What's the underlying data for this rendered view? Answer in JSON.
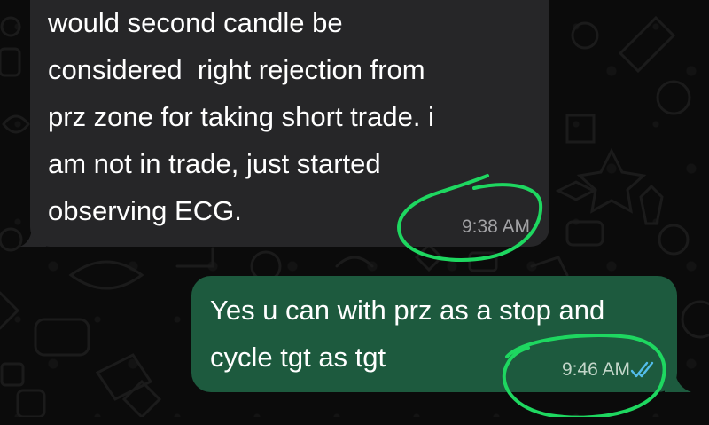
{
  "messages": [
    {
      "direction": "incoming",
      "text": "would second candle be\nconsidered  right rejection from\nprz zone for taking short trade. i\nam not in trade, just started\nobserving ECG.",
      "time": "9:38 AM"
    },
    {
      "direction": "outgoing",
      "text": "Yes u can with prz as a stop and\ncycle tgt as tgt",
      "time": "9:46 AM",
      "status": "read",
      "status_icon": "double-check-icon"
    }
  ],
  "colors": {
    "background": "#0b0b0b",
    "incoming_bubble": "#262628",
    "outgoing_bubble": "#1d5a3e",
    "read_ticks": "#53bdeb",
    "annotation": "#1ed760"
  },
  "annotations": [
    {
      "type": "hand-drawn-circle",
      "around": "messages.0.time"
    },
    {
      "type": "hand-drawn-circle",
      "around": "messages.1.time"
    }
  ]
}
